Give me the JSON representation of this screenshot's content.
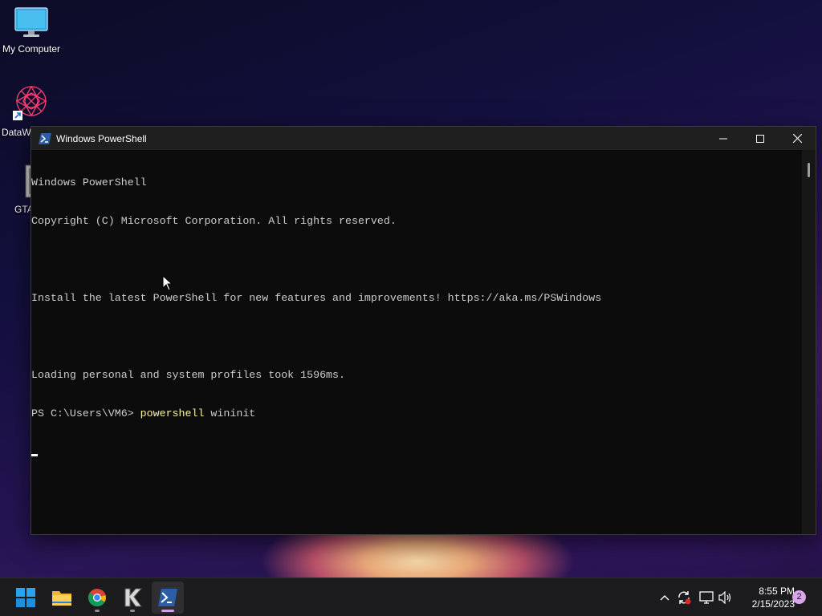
{
  "desktop": {
    "icons": [
      {
        "label": "My Computer"
      },
      {
        "label": "DataW"
      },
      {
        "label": "GTA And"
      }
    ]
  },
  "window": {
    "title": "Windows PowerShell",
    "controls": {
      "minimize": "─",
      "maximize": "☐",
      "close": "✕"
    }
  },
  "console": {
    "lines": [
      "Windows PowerShell",
      "Copyright (C) Microsoft Corporation. All rights reserved.",
      "",
      "Install the latest PowerShell for new features and improvements! https://aka.ms/PSWindows",
      "",
      "Loading personal and system profiles took 1596ms."
    ],
    "prompt": "PS C:\\Users\\VM6> ",
    "command": "powershell",
    "argument": " wininit"
  },
  "taskbar": {
    "apps": [
      {
        "name": "start-button"
      },
      {
        "name": "file-explorer"
      },
      {
        "name": "chrome"
      },
      {
        "name": "k-app"
      },
      {
        "name": "powershell"
      }
    ],
    "clock": {
      "time": "8:55 PM",
      "date": "2/15/2023"
    },
    "notification_count": "2"
  },
  "colors": {
    "console_bg": "#0c0c0c",
    "console_text": "#cccccc",
    "command_text": "#f9f1a5",
    "titlebar_bg": "#1f1f1f",
    "taskbar_bg": "#1c1c1f",
    "powershell_blue": "#2b5ea7",
    "notif_badge": "#d9a6ec"
  }
}
